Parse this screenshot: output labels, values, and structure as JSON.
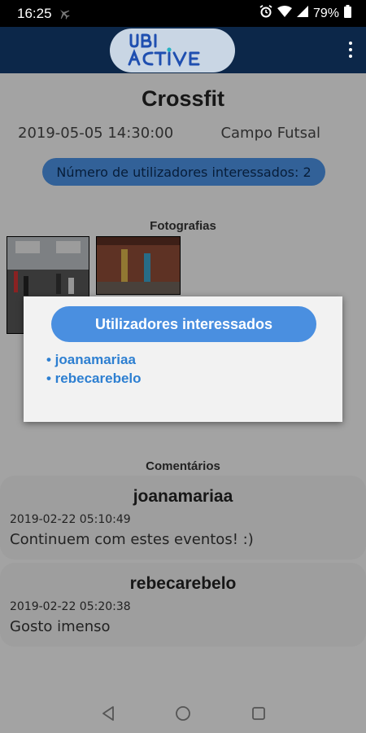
{
  "status_bar": {
    "time": "16:25",
    "battery": "79%",
    "icons": [
      "airplane-mode-icon",
      "alarm-icon",
      "wifi-icon",
      "signal-icon",
      "battery-icon"
    ]
  },
  "app_bar": {
    "logo_text": "UBI ACTIVE",
    "menu_icon": "overflow-menu-icon"
  },
  "event": {
    "title": "Crossfit",
    "datetime": "2019-05-05 14:30:00",
    "location": "Campo Futsal",
    "interested_label": "Número de utilizadores interessados: 2"
  },
  "photos": {
    "label": "Fotografias"
  },
  "comments": {
    "label": "Comentários",
    "items": [
      {
        "user": "joanamariaa",
        "date": "2019-02-22 05:10:49",
        "text": "Continuem com estes eventos! :)"
      },
      {
        "user": "rebecarebelo",
        "date": "2019-02-22 05:20:38",
        "text": "Gosto imenso"
      }
    ]
  },
  "dialog": {
    "title": "Utilizadores interessados",
    "users": [
      "• joanamariaa",
      "• rebecarebelo"
    ]
  },
  "nav_bar": {
    "buttons": [
      "back-icon",
      "home-icon",
      "recents-icon"
    ]
  },
  "colors": {
    "app_bar": "#0c2749",
    "accent_blue": "#4a8fe0",
    "link_blue": "#2d7fd1"
  }
}
